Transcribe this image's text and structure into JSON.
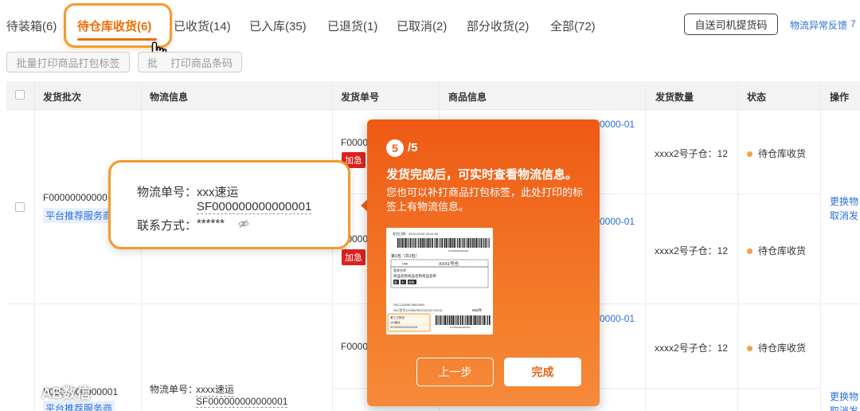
{
  "tabs": [
    {
      "label": "待装箱(6)",
      "active": false
    },
    {
      "label": "待仓库收货(6)",
      "active": true
    },
    {
      "label": "已收货(14)",
      "active": false
    },
    {
      "label": "已入库(35)",
      "active": false
    },
    {
      "label": "已退货(1)",
      "active": false
    },
    {
      "label": "已取消(2)",
      "active": false
    },
    {
      "label": "部分收货(2)",
      "active": false
    },
    {
      "label": "全部(72)",
      "active": false
    }
  ],
  "header_actions": {
    "driver_code_button": "自送司机提货码",
    "logistics_exception_link": "物流异常反馈",
    "overflow_link": "7"
  },
  "batch_actions": {
    "print_pack_labels": "批量打印商品打包标签",
    "print_barcodes_prefix": "批",
    "print_barcodes_suffix": "打印商品条码"
  },
  "table": {
    "headers": {
      "batch": "发货批次",
      "logistics": "物流信息",
      "shipment_no": "发货单号",
      "product": "商品信息",
      "quantity": "发货数量",
      "status": "状态",
      "actions": "操作"
    },
    "rows": [
      {
        "batch_no": "F00000000000",
        "platform_tag": "平台推荐服务商",
        "shipment_no": "F0000",
        "urgent_tag": "加急",
        "product_code": "0000-01",
        "quantity": "xxxx2号子仓：12",
        "status": "待仓库收货"
      },
      {
        "shipment_no": "F0000",
        "urgent_tag": "加急",
        "product_code": "0000-01",
        "quantity": "xxxx2号子仓：12",
        "status": "待仓库收货",
        "action_change": "更换物",
        "action_cancel": "取消发"
      },
      {
        "batch_no": "F0000000000001",
        "platform_tag": "平台推荐服务商",
        "logistics_label": "物流单号：",
        "logistics_carrier": "xxxx速运",
        "logistics_tracking": "SF000000000000001",
        "shipment_no": "F0000",
        "product_code": "0000-01",
        "quantity": "xxxx2号子仓：12",
        "status": "待仓库收货",
        "action_change": "更换物",
        "action_cancel": "取消发"
      }
    ]
  },
  "callout": {
    "tracking_label": "物流单号：",
    "carrier": "xxx速运",
    "tracking_no": "SF000000000000001",
    "contact_label": "联系方式：",
    "contact_masked": "******"
  },
  "guide": {
    "step": "5",
    "total": "/5",
    "title": "发货完成后，可实时查看物流信息。",
    "description": "您也可以补打商品打包标签，此处打印的标签上有物流信息。",
    "prev_button": "上一步",
    "done_button": "完成",
    "label_sample": {
      "date": "发货日期：2023-04-06 20:41:00",
      "barcode_no": "PC0000000000001",
      "pack": "第1包（共1包）",
      "vmi": "VMI",
      "warehouse": "XXX1号仓",
      "package_name": "套装名称",
      "product_name": "商品名称商品名称商品名称",
      "chips": [
        "蓝",
        "大",
        "其他"
      ],
      "skc": "SKC12345678900000",
      "skc_detail": "SKC货号12345678911131517​19212",
      "count": "666件",
      "third_party": "第三方物流",
      "carrier": "xxx速运",
      "tracking": "SF000000000000001",
      "barcode_no2": "PC0000000000001"
    }
  },
  "watermark": "AB数信"
}
